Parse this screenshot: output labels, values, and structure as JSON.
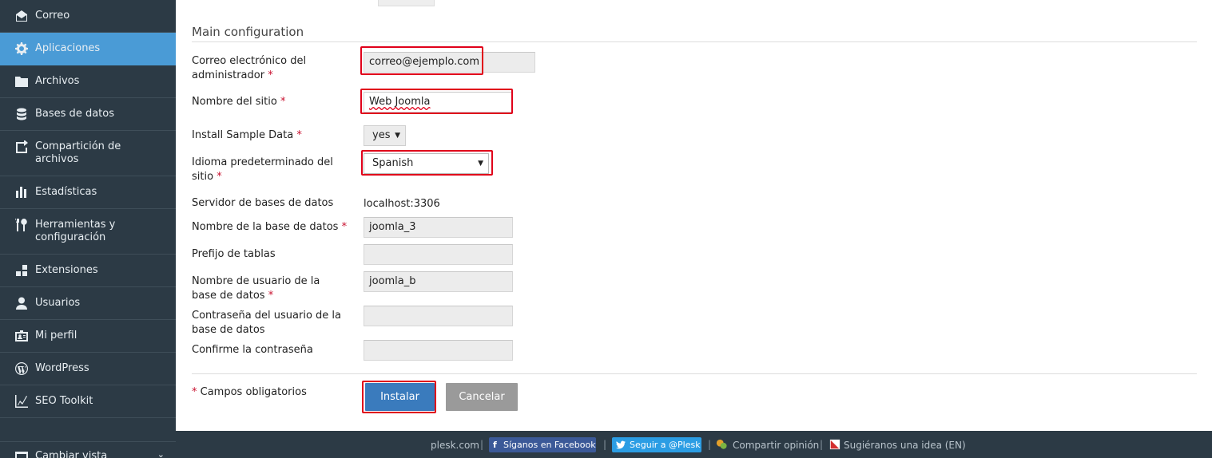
{
  "sidebar": {
    "items": [
      {
        "label": "Correo",
        "icon": "mail-icon",
        "active": false
      },
      {
        "label": "Aplicaciones",
        "icon": "gear-icon",
        "active": true
      },
      {
        "label": "Archivos",
        "icon": "folder-icon",
        "active": false
      },
      {
        "label": "Bases de datos",
        "icon": "database-icon",
        "active": false
      },
      {
        "label": "Compartición de archivos",
        "icon": "share-icon",
        "active": false
      },
      {
        "label": "Estadísticas",
        "icon": "bar-chart-icon",
        "active": false
      },
      {
        "label": "Herramientas y configuración",
        "icon": "tools-icon",
        "active": false
      },
      {
        "label": "Extensiones",
        "icon": "extensions-icon",
        "active": false
      },
      {
        "label": "Usuarios",
        "icon": "user-icon",
        "active": false
      },
      {
        "label": "Mi perfil",
        "icon": "profile-icon",
        "active": false
      },
      {
        "label": "WordPress",
        "icon": "wordpress-icon",
        "active": false
      },
      {
        "label": "SEO Toolkit",
        "icon": "seo-icon",
        "active": false
      },
      {
        "label": "Cambiar vista",
        "icon": "switch-view-icon",
        "active": false
      }
    ]
  },
  "form": {
    "section_title": "Main configuration",
    "required_mark": "*",
    "admin_email_label": "Correo electrónico del administrador",
    "admin_email_value": "correo@ejemplo.com",
    "site_name_label": "Nombre del sitio",
    "site_name_value": "Web Joomla",
    "sample_data_label": "Install Sample Data",
    "sample_data_value": "yes",
    "language_label": "Idioma predeterminado del sitio",
    "language_value": "Spanish",
    "db_server_label": "Servidor de bases de datos",
    "db_server_value": "localhost:3306",
    "db_name_label": "Nombre de la base de datos",
    "db_name_value": "joomla_3",
    "table_prefix_label": "Prefijo de tablas",
    "table_prefix_value": "",
    "db_user_label": "Nombre de usuario de la base de datos",
    "db_user_value": "joomla_b",
    "db_password_label": "Contraseña del usuario de la base de datos",
    "db_password_value": "",
    "confirm_password_label": "Confirme la contraseña",
    "confirm_password_value": "",
    "required_note": "Campos obligatorios",
    "install_button": "Instalar",
    "cancel_button": "Cancelar"
  },
  "footer": {
    "site_link": "plesk.com",
    "facebook_label": "Síganos en Facebook",
    "twitter_label": "Seguir a @Plesk",
    "feedback_label": "Compartir opinión",
    "suggest_label": "Sugiéranos una idea (EN)",
    "separator": "|"
  },
  "colors": {
    "sidebar_bg": "#2c3a45",
    "active_item": "#4a9bd6",
    "primary_button": "#3a7bbd",
    "highlight_border": "#e0001a"
  }
}
